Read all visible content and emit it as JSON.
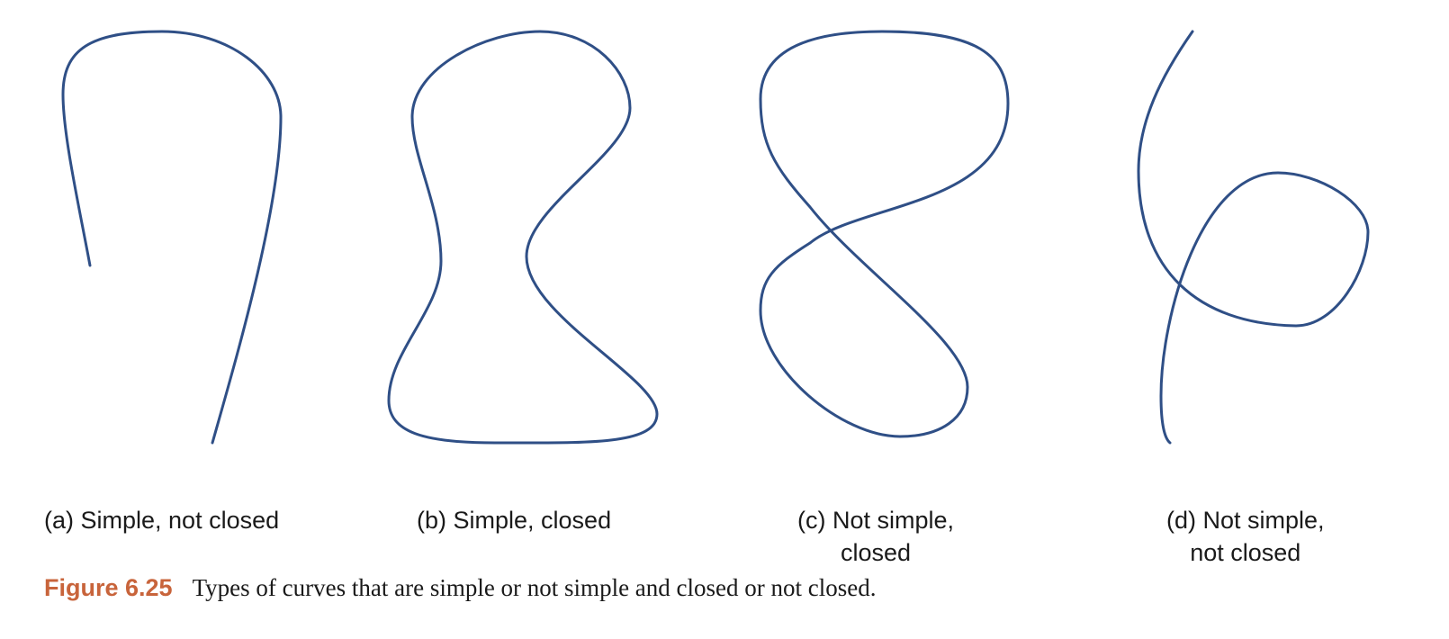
{
  "colors": {
    "curve_stroke": "#2f4f86",
    "caption_number": "#c8643b",
    "text": "#1a1a1a"
  },
  "curves": [
    {
      "id": "a",
      "label_lines": [
        "(a) Simple, not closed"
      ],
      "simple": true,
      "closed": false
    },
    {
      "id": "b",
      "label_lines": [
        "(b) Simple, closed"
      ],
      "simple": true,
      "closed": true
    },
    {
      "id": "c",
      "label_lines": [
        "(c) Not simple,",
        "closed"
      ],
      "simple": false,
      "closed": true
    },
    {
      "id": "d",
      "label_lines": [
        "(d) Not simple,",
        "not closed"
      ],
      "simple": false,
      "closed": false
    }
  ],
  "caption": {
    "number": "Figure 6.25",
    "text": "Types of curves that are simple or not simple and closed or not closed."
  }
}
